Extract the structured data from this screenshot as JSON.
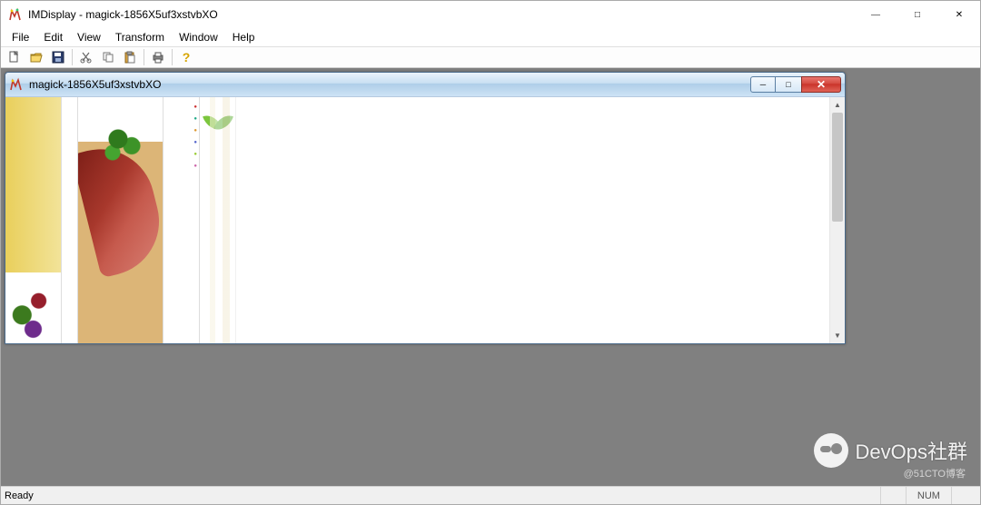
{
  "titlebar": {
    "app_name": "IMDisplay",
    "document": "magick-1856X5uf3xstvbXO",
    "full_title": "IMDisplay - magick-1856X5uf3xstvbXO"
  },
  "menubar": [
    "File",
    "Edit",
    "View",
    "Transform",
    "Window",
    "Help"
  ],
  "toolbar": {
    "new": "new-file",
    "open": "open-file",
    "save": "save-file",
    "cut": "cut",
    "copy": "copy",
    "paste": "paste",
    "print": "print",
    "help": "help"
  },
  "child_window": {
    "title": "magick-1856X5uf3xstvbXO"
  },
  "statusbar": {
    "left": "Ready",
    "num": "NUM"
  },
  "watermark": {
    "text": "DevOps社群",
    "credit": "@51CTO博客"
  }
}
